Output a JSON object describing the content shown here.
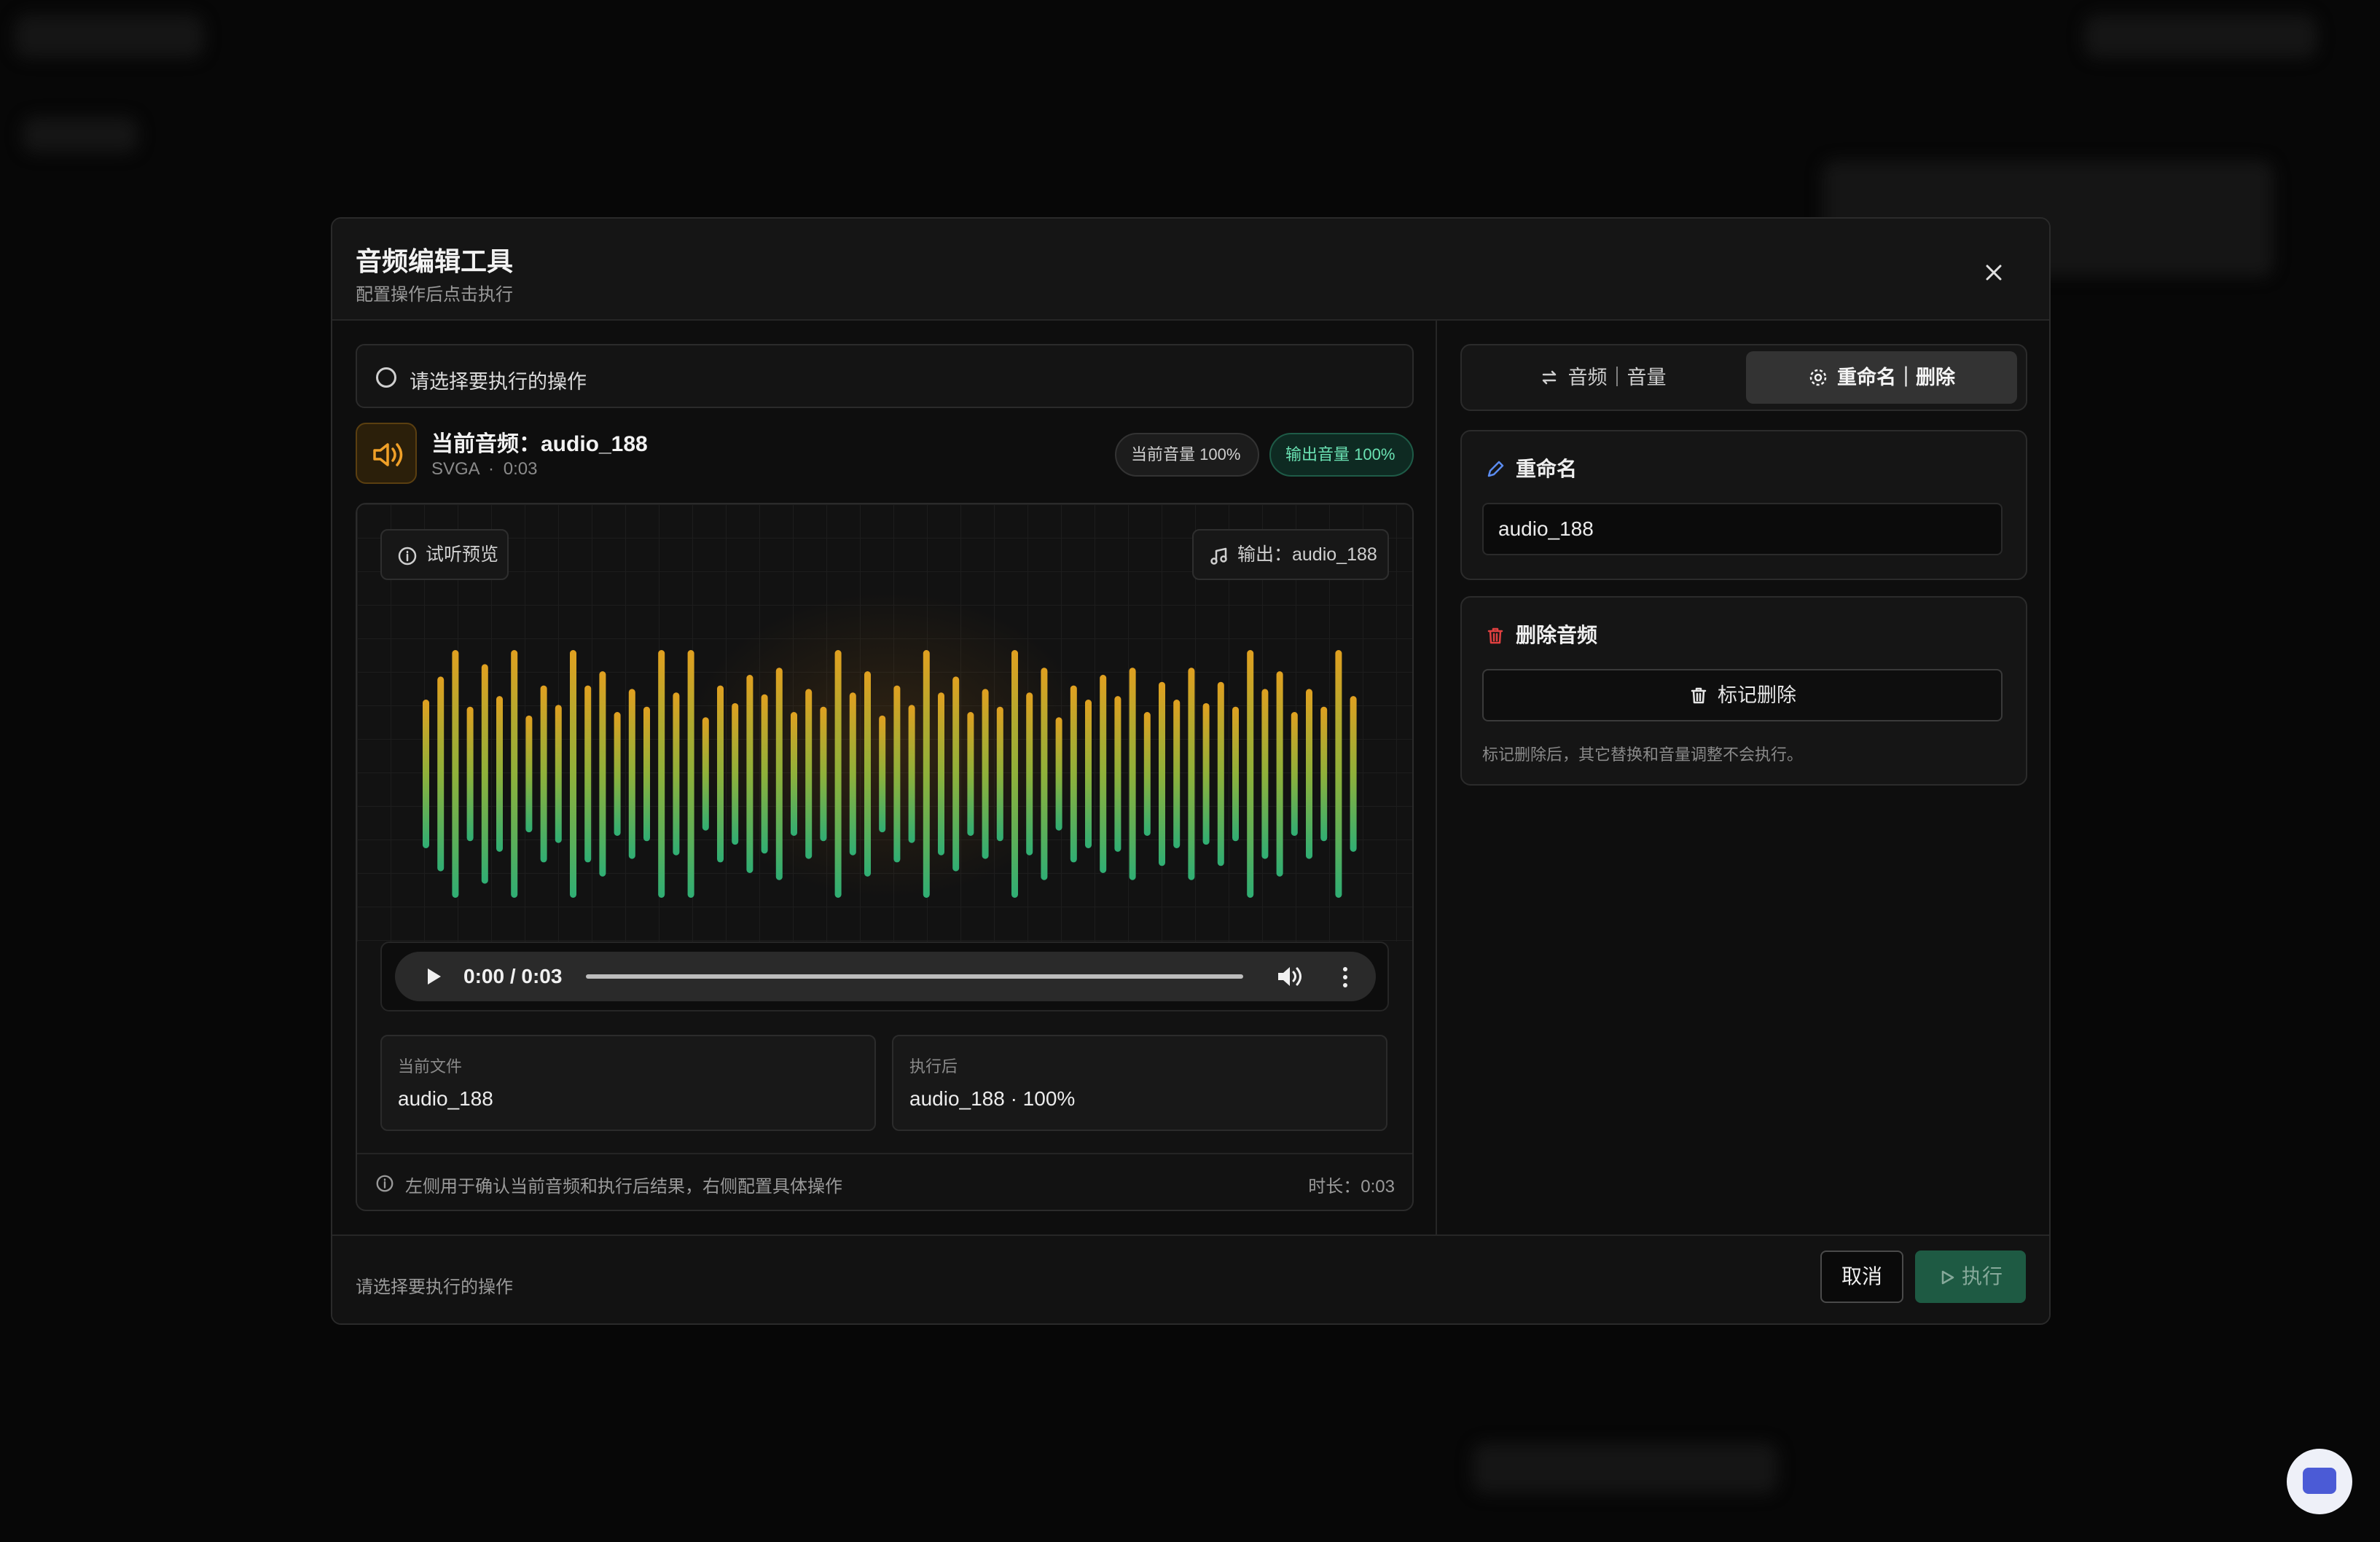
{
  "dialog": {
    "title": "音频编辑工具",
    "subtitle": "配置操作后点击执行"
  },
  "operation_select": {
    "placeholder": "请选择要执行的操作"
  },
  "current_audio": {
    "label": "当前音频：audio_188",
    "format": "SVGA",
    "separator": "·",
    "duration": "0:03",
    "current_volume_pill": "当前音量 100%",
    "output_volume_pill": "输出音量 100%"
  },
  "preview": {
    "listen_label": "试听预览",
    "output_label": "输出：audio_188",
    "waveform_levels": [
      0.42,
      0.55,
      0.7,
      0.38,
      0.62,
      0.44,
      0.7,
      0.33,
      0.5,
      0.39,
      0.7,
      0.5,
      0.58,
      0.35,
      0.48,
      0.38,
      0.7,
      0.46,
      0.7,
      0.32,
      0.5,
      0.4,
      0.56,
      0.45,
      0.6,
      0.35,
      0.48,
      0.38,
      0.7,
      0.46,
      0.58,
      0.33,
      0.5,
      0.39,
      0.7,
      0.46,
      0.55,
      0.35,
      0.48,
      0.38,
      0.7,
      0.46,
      0.6,
      0.32,
      0.5,
      0.42,
      0.56,
      0.44,
      0.6,
      0.35,
      0.52,
      0.42,
      0.6,
      0.4,
      0.52,
      0.38,
      0.7,
      0.48,
      0.58,
      0.35,
      0.48,
      0.38,
      0.7,
      0.44
    ],
    "player": {
      "time": "0:00 / 0:03"
    },
    "current_file": {
      "label": "当前文件",
      "value": "audio_188"
    },
    "after_exec": {
      "label": "执行后",
      "value": "audio_188 · 100%"
    },
    "footer_hint": "左侧用于确认当前音频和执行后结果，右侧配置具体操作",
    "duration_label": "时长：0:03"
  },
  "tabs": [
    {
      "label": "音频｜音量",
      "active": false
    },
    {
      "label": "重命名｜删除",
      "active": true
    }
  ],
  "rename": {
    "title": "重命名",
    "value": "audio_188"
  },
  "delete": {
    "title": "删除音频",
    "button_label": "标记删除",
    "note": "标记删除后，其它替换和音量调整不会执行。"
  },
  "footer": {
    "status": "请选择要执行的操作",
    "cancel_label": "取消",
    "execute_label": "执行"
  },
  "colors": {
    "accent_orange": "#e0a020",
    "accent_green": "#3ba878",
    "delete_red": "#e04040",
    "edit_blue": "#5b8cf0"
  },
  "icons": {
    "close": "close-icon",
    "speaker": "speaker-icon",
    "info": "info-icon",
    "music": "music-note-icon",
    "swap": "swap-icon",
    "gear": "gear-icon",
    "pencil": "pencil-icon",
    "trash": "trash-icon",
    "play": "play-icon",
    "chat": "chat-icon"
  }
}
